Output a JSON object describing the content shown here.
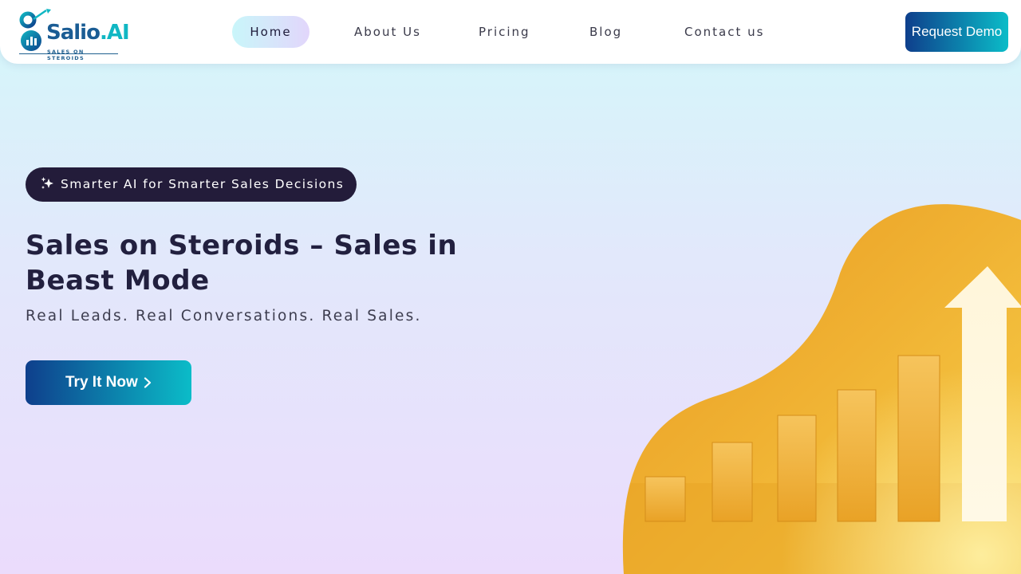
{
  "brand": {
    "name": "Salio",
    "tld": ".AI",
    "tagline": "SALES ON STEROIDS",
    "primary_color": "#0e3f8c",
    "accent_color": "#0bbcc8"
  },
  "nav": {
    "items": [
      {
        "label": "Home",
        "active": true
      },
      {
        "label": "About Us"
      },
      {
        "label": "Pricing"
      },
      {
        "label": "Blog"
      },
      {
        "label": "Contact us"
      }
    ],
    "cta_label": "Request Demo"
  },
  "hero": {
    "badge_icon": "sparkles-icon",
    "badge_text": "Smarter AI for Smarter Sales Decisions",
    "title": "Sales on Steroids – Sales in Beast Mode",
    "subtitle": "Real Leads. Real Conversations. Real Sales.",
    "cta_label": "Try It Now",
    "cta_icon": "chevron-right-icon",
    "image_icon": "growth-bar-chart-arrow-icon"
  }
}
